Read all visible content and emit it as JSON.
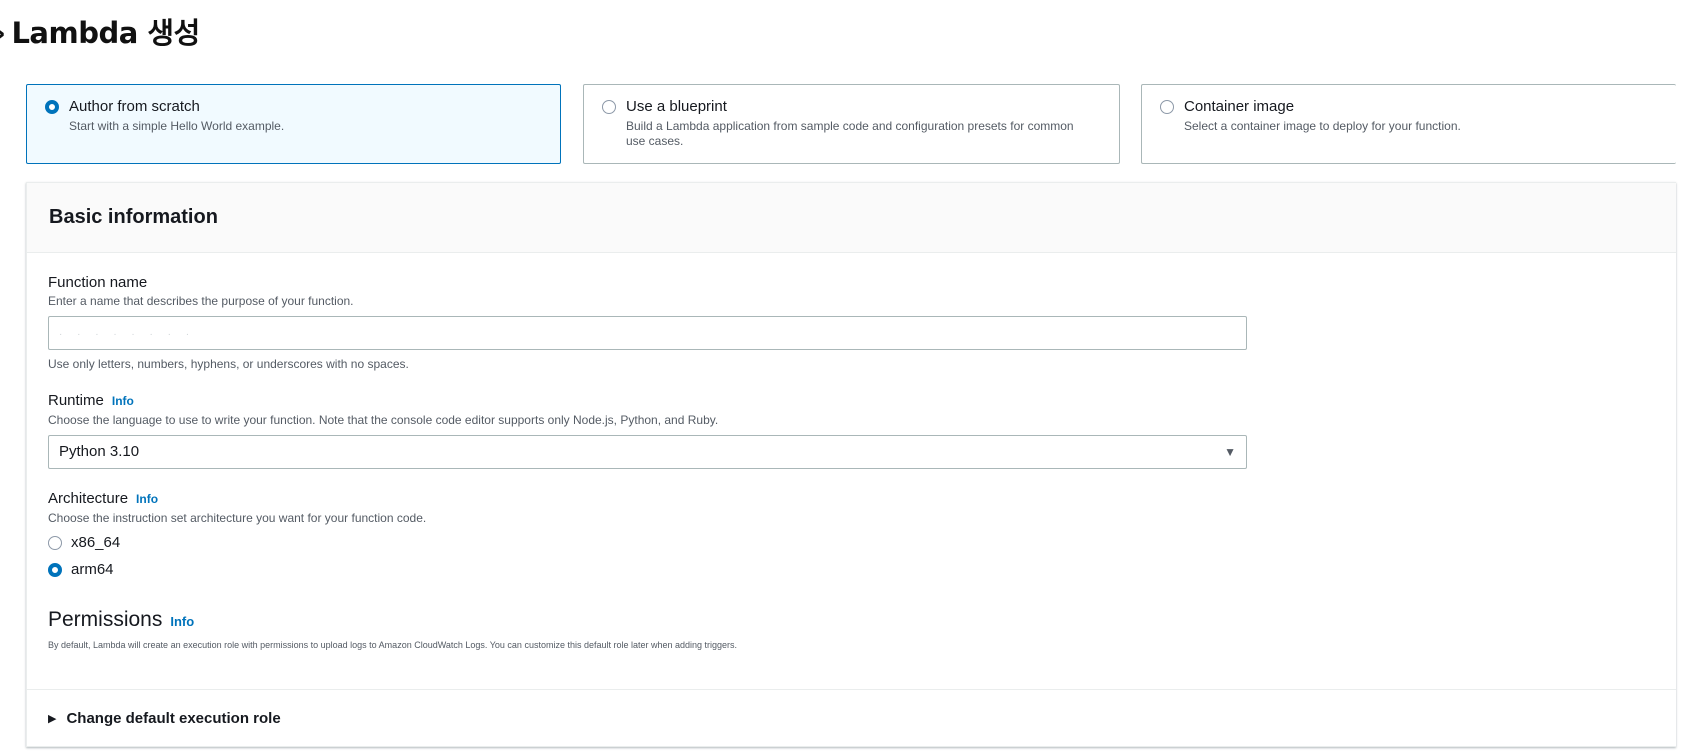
{
  "page": {
    "heading": "Lambda 생성",
    "heading_bullet": "›"
  },
  "options": [
    {
      "title": "Author from scratch",
      "desc": "Start with a simple Hello World example.",
      "selected": true
    },
    {
      "title": "Use a blueprint",
      "desc": "Build a Lambda application from sample code and configuration presets for common use cases.",
      "selected": false
    },
    {
      "title": "Container image",
      "desc": "Select a container image to deploy for your function.",
      "selected": false
    }
  ],
  "basic_info": {
    "title": "Basic information"
  },
  "function_name": {
    "label": "Function name",
    "desc": "Enter a name that describes the purpose of your function.",
    "value": "· · · · · · · ·",
    "hint": "Use only letters, numbers, hyphens, or underscores with no spaces."
  },
  "runtime": {
    "label": "Runtime",
    "info": "Info",
    "desc": "Choose the language to use to write your function. Note that the console code editor supports only Node.js, Python, and Ruby.",
    "value": "Python 3.10",
    "caret": "▼"
  },
  "architecture": {
    "label": "Architecture",
    "info": "Info",
    "desc": "Choose the instruction set architecture you want for your function code.",
    "options": [
      {
        "label": "x86_64",
        "selected": false
      },
      {
        "label": "arm64",
        "selected": true
      }
    ]
  },
  "permissions": {
    "title": "Permissions",
    "info": "Info",
    "desc": "By default, Lambda will create an execution role with permissions to upload logs to Amazon CloudWatch Logs. You can customize this default role later when adding triggers."
  },
  "execution_role": {
    "label": "Change default execution role",
    "icon": "caret-right-icon",
    "glyph": "▶"
  },
  "colors": {
    "accent": "#0073bb",
    "selected_card_bg": "#f1faff",
    "border": "#aab7b8"
  }
}
